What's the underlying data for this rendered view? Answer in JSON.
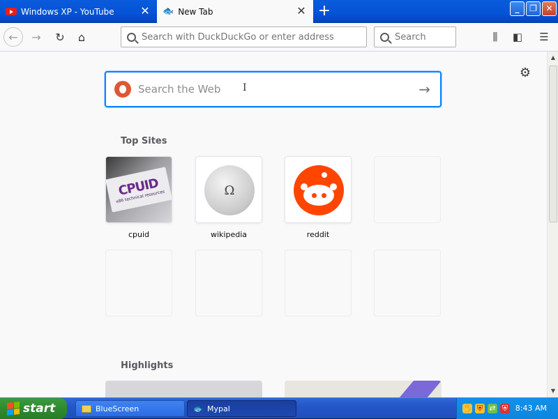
{
  "tabs": [
    {
      "title": "Windows XP - YouTube",
      "close": "✕"
    },
    {
      "title": "New Tab",
      "close": "✕"
    }
  ],
  "new_tab_symbol": "+",
  "window_controls": {
    "minimize": "_",
    "maximize": "❐",
    "close": "✕"
  },
  "toolbar": {
    "address_placeholder": "Search with DuckDuckGo or enter address",
    "search_placeholder": "Search"
  },
  "new_tab_page": {
    "web_search_placeholder": "Search the Web",
    "top_sites_title": "Top Sites",
    "top_sites": [
      {
        "label": "cpuid",
        "tile_text": "CPUID",
        "tile_subtext": "x86 technical resources"
      },
      {
        "label": "wikipedia",
        "tile_text": "Ω"
      },
      {
        "label": "reddit"
      }
    ],
    "highlights_title": "Highlights"
  },
  "taskbar": {
    "start_label": "start",
    "items": [
      {
        "label": "BlueScreen"
      },
      {
        "label": "Mypal"
      }
    ],
    "clock": "8:43 AM"
  },
  "colors": {
    "accent": "#0a84ff",
    "reddit": "#ff4500",
    "ddg": "#de5833",
    "xp_blue": "#0553d6"
  }
}
